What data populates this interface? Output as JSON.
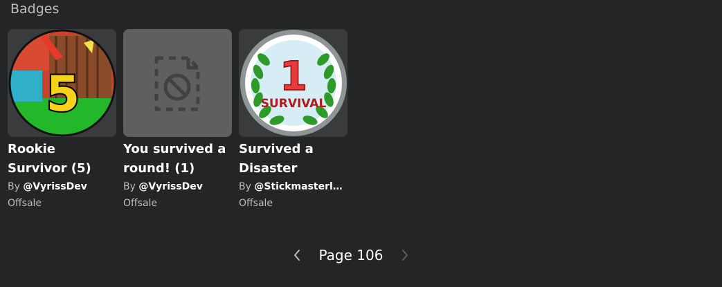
{
  "section": {
    "title": "Badges"
  },
  "badges": [
    {
      "name": "Rookie Survivor (5)",
      "by": "By",
      "creator": "@VyrissDev",
      "price": "Offsale",
      "icon": "rookie-survivor-badge-image",
      "badge_number": "5"
    },
    {
      "name": "You survived a round! (1)",
      "by": "By",
      "creator": "@VyrissDev",
      "price": "Offsale",
      "icon": "unavailable-image-icon"
    },
    {
      "name": "Survived a Disaster",
      "by": "By",
      "creator": "@Stickmasterl…",
      "price": "Offsale",
      "icon": "survival-badge-image",
      "badge_number": "1",
      "badge_text": "SURVIVAL"
    }
  ],
  "pagination": {
    "label": "Page 106",
    "prev_icon": "chevron-left-icon",
    "next_icon": "chevron-right-icon"
  },
  "colors": {
    "background": "#232527",
    "card": "#393b3d",
    "placeholder": "#5d5f61",
    "muted_text": "#bdbebe",
    "text": "#ffffff"
  }
}
